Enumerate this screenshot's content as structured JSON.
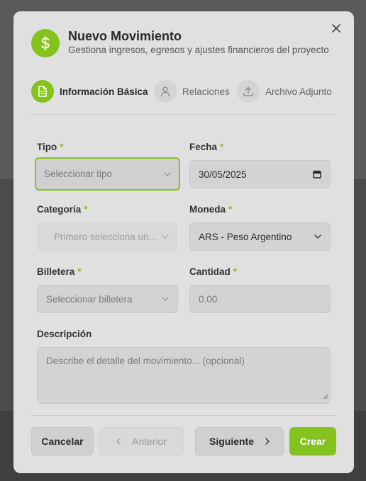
{
  "modal": {
    "title": "Nuevo Movimiento",
    "subtitle": "Gestiona ingresos, egresos y ajustes financieros del proyecto",
    "header_icon": "dollar-icon",
    "close_icon": "close-icon"
  },
  "steps": [
    {
      "label": "Información Básica",
      "icon": "document-icon",
      "active": true
    },
    {
      "label": "Relaciones",
      "icon": "user-icon",
      "active": false
    },
    {
      "label": "Archivo Adjunto",
      "icon": "upload-icon",
      "active": false
    }
  ],
  "form": {
    "required_marker": "*",
    "tipo": {
      "label": "Tipo",
      "placeholder": "Seleccionar tipo",
      "required": true
    },
    "fecha": {
      "label": "Fecha",
      "value": "30/05/2025",
      "required": true
    },
    "categoria": {
      "label": "Categoría",
      "placeholder": "Primero selecciona un...",
      "required": true
    },
    "moneda": {
      "label": "Moneda",
      "value": "ARS - Peso Argentino",
      "required": true
    },
    "billetera": {
      "label": "Billetera",
      "placeholder": "Seleccionar billetera",
      "required": true
    },
    "cantidad": {
      "label": "Cantidad",
      "placeholder": "0.00",
      "required": true
    },
    "descripcion": {
      "label": "Descripción",
      "placeholder": "Describe el detalle del movimiento... (opcional)"
    }
  },
  "footer": {
    "cancel": "Cancelar",
    "previous": "Anterior",
    "next": "Siguiente",
    "create": "Crear"
  },
  "colors": {
    "accent": "#84c21e",
    "modal_bg": "#e0e0e0",
    "field_bg": "#d3d3d3",
    "overlay": "#4b4b4b"
  }
}
